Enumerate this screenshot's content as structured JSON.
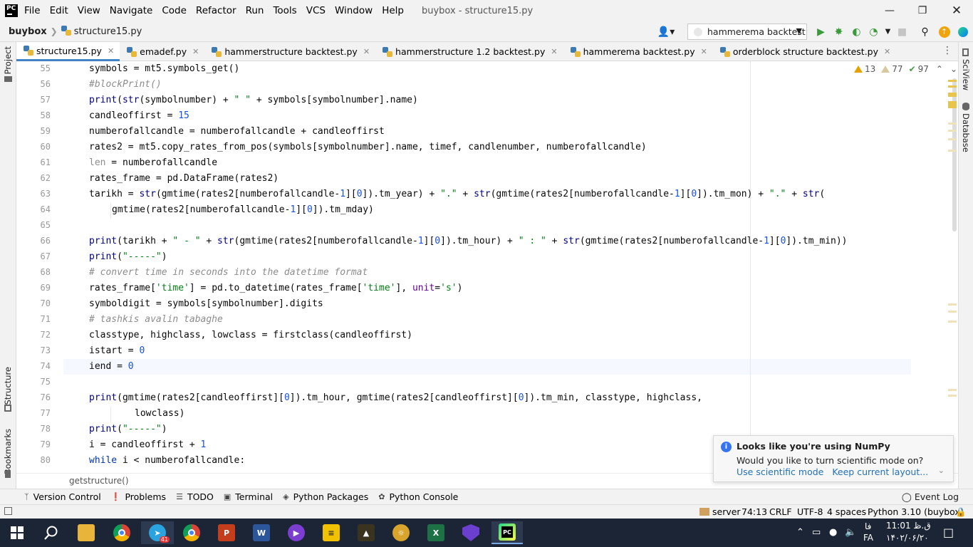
{
  "titlebar": {
    "menu": [
      "File",
      "Edit",
      "View",
      "Navigate",
      "Code",
      "Refactor",
      "Run",
      "Tools",
      "VCS",
      "Window",
      "Help"
    ],
    "title": "buybox - structure15.py",
    "logo_text": "PC"
  },
  "navbar": {
    "project": "buybox",
    "file": "structure15.py",
    "run_config": "hammerema backtest"
  },
  "tabs": [
    {
      "label": "structure15.py",
      "active": true
    },
    {
      "label": "emadef.py",
      "active": false
    },
    {
      "label": "hammerstructure backtest.py",
      "active": false
    },
    {
      "label": "hammerstructure 1.2 backtest.py",
      "active": false
    },
    {
      "label": "hammerema backtest.py",
      "active": false
    },
    {
      "label": "orderblock structure backtest.py",
      "active": false
    }
  ],
  "left_strip": {
    "project": "Project",
    "structure": "Structure",
    "bookmarks": "Bookmarks"
  },
  "right_strip": {
    "sciview": "SciView",
    "database": "Database"
  },
  "inspections": {
    "warnings": "13",
    "weak_warnings": "77",
    "typos": "97"
  },
  "editor": {
    "line_numbers": [
      "55",
      "56",
      "57",
      "58",
      "59",
      "60",
      "61",
      "62",
      "63",
      "64",
      "65",
      "66",
      "67",
      "68",
      "69",
      "70",
      "71",
      "72",
      "73",
      "74",
      "75",
      "76",
      "77",
      "78",
      "79",
      "80"
    ],
    "current_line": "74"
  },
  "breadcrumb": "getstructure()",
  "toolwindows": [
    "Version Control",
    "Problems",
    "TODO",
    "Terminal",
    "Python Packages",
    "Python Console"
  ],
  "event_log": "Event Log",
  "statusbar": {
    "server": "server",
    "position": "74:13",
    "line_sep": "CRLF",
    "encoding": "UTF-8",
    "indent": "4 spaces",
    "interpreter": "Python 3.10 (buybox)"
  },
  "notification": {
    "title": "Looks like you're using NumPy",
    "body": "Would you like to turn scientific mode on?",
    "link_use": "Use scientific mode",
    "link_keep": "Keep current layout..."
  },
  "taskbar": {
    "clock_time": "11:01 ق.ظ",
    "clock_date": "۱۴۰۲/۰۶/۲۰",
    "lang_top": "فا",
    "lang_bottom": "FA",
    "telegram_badge": "41"
  },
  "colors": {
    "accent": "#4083c9",
    "taskbar": "#1b2535",
    "link": "#2470b3"
  }
}
